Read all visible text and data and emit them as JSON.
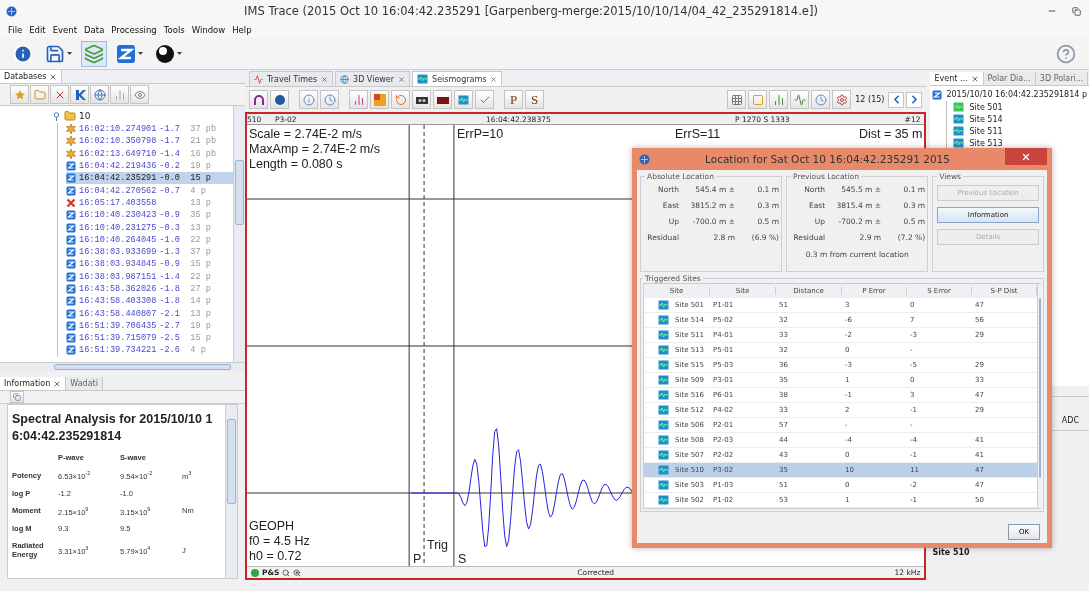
{
  "window": {
    "title": "IMS Trace (2015 Oct 10 16:04:42.235291 [Garpenberg-merge:2015/10/10/14/04_42_235291814.e])"
  },
  "menu": [
    "File",
    "Edit",
    "Event",
    "Data",
    "Processing",
    "Tools",
    "Window",
    "Help"
  ],
  "databases": {
    "tab": "Databases",
    "tree": [
      {
        "label": "10",
        "expanded": true,
        "children": [
          {
            "kind": "star",
            "time": "16:02:10.274901",
            "mag": "-1.7",
            "count": "37 pb",
            "selected": false
          },
          {
            "kind": "star",
            "time": "16:02:10.350798",
            "mag": "-1.7",
            "count": "21 pb",
            "selected": false
          },
          {
            "kind": "star",
            "time": "16:02:13.649710",
            "mag": "-1.4",
            "count": "16 pb",
            "selected": false
          },
          {
            "kind": "z",
            "time": "16:04:42.219436",
            "mag": "-0.2",
            "count": "19 p",
            "selected": false
          },
          {
            "kind": "z",
            "time": "16:04:42.235291",
            "mag": "-0.0",
            "count": "15 p",
            "selected": true
          },
          {
            "kind": "z",
            "time": "16:04:42.270562",
            "mag": "-0.7",
            "count": "4 p",
            "selected": false
          },
          {
            "kind": "x",
            "time": "16:05:17.403558",
            "count": "13 p",
            "selected": false
          },
          {
            "kind": "z",
            "time": "16:10:40.230423",
            "mag": "-0.9",
            "count": "35 p",
            "selected": false
          },
          {
            "kind": "z",
            "time": "16:10:40.231275",
            "mag": "-0.3",
            "count": "13 p",
            "selected": false
          },
          {
            "kind": "z",
            "time": "16:10:40.264045",
            "mag": "-1.0",
            "count": "22 p",
            "selected": false
          },
          {
            "kind": "z",
            "time": "16:38:03.933699",
            "mag": "-1.3",
            "count": "37 p",
            "selected": false
          },
          {
            "kind": "z",
            "time": "16:38:03.934845",
            "mag": "-0.9",
            "count": "15 p",
            "selected": false
          },
          {
            "kind": "z",
            "time": "16:38:03.987151",
            "mag": "-1.4",
            "count": "22 p",
            "selected": false
          },
          {
            "kind": "z",
            "time": "16:43:58.362026",
            "mag": "-1.8",
            "count": "27 p",
            "selected": false
          },
          {
            "kind": "z",
            "time": "16:43:58.403308",
            "mag": "-1.8",
            "count": "14 p",
            "selected": false
          },
          {
            "kind": "z",
            "time": "16:43:58.440807",
            "mag": "-2.1",
            "count": "13 p",
            "selected": false
          },
          {
            "kind": "z",
            "time": "16:51:39.706435",
            "mag": "-2.7",
            "count": "19 p",
            "selected": false
          },
          {
            "kind": "z",
            "time": "16:51:39.715079",
            "mag": "-2.5",
            "count": "15 p",
            "selected": false
          },
          {
            "kind": "z",
            "time": "16:51:39.734221",
            "mag": "-2.6",
            "count": "4 p",
            "selected": false
          }
        ]
      }
    ]
  },
  "information": {
    "tabs": [
      {
        "label": "Information",
        "selected": true
      },
      {
        "label": "Wadati",
        "selected": false
      }
    ],
    "heading": "Spectral Analysis for 2015/10/10 16:04:42.235291814",
    "columns": [
      "P-wave",
      "S-wave"
    ],
    "rows": [
      {
        "label": "Potency",
        "p": "6.53×10$^{-2}$",
        "s": "9.54×10$^{-2}$",
        "unit": "m$^{3}$"
      },
      {
        "label": "log P",
        "p": "-1.2",
        "s": "-1.0"
      },
      {
        "label": "Moment",
        "p": "2.15×10$^{9}$",
        "s": "3.15×10$^{9}$",
        "unit": "Nm"
      },
      {
        "label": "log M",
        "p": "9.3",
        "s": "9.5"
      },
      {
        "label": "Radiated Energy",
        "p": "3.31×10$^{3}$",
        "s": "5.79×10$^{4}$",
        "unit": "J"
      }
    ]
  },
  "center": {
    "tabs": [
      {
        "label": "Travel Times",
        "selected": false
      },
      {
        "label": "3D Viewer",
        "selected": false
      },
      {
        "label": "Seismograms",
        "selected": true
      }
    ],
    "pick_buttons": [
      "P",
      "S"
    ],
    "trace_count": "12 (15)",
    "header": [
      "510",
      "P3-02",
      "16:04:42.238375",
      "P 1270 S 1333",
      "#12"
    ],
    "info": [
      "Scale = 2.74E-2 m/s",
      "MaxAmp = 2.74E-2 m/s",
      "Length = 0.080 s"
    ],
    "err_p": "ErrP=10",
    "err_s": "ErrS=11",
    "dist": "Dist = 35 m",
    "sensor": [
      "GEOPH",
      "f0 = 4.5 Hz",
      "h0 = 0.72"
    ],
    "picks": {
      "p": "P",
      "trig": "Trig",
      "s": "S"
    },
    "status": {
      "mode": "P&S",
      "correction": "Corrected",
      "rate": "12 kHz"
    }
  },
  "right": {
    "tabs": [
      {
        "label": "Event ...",
        "selected": true
      },
      {
        "label": "Polar Dia...",
        "selected": false
      },
      {
        "label": "3D Polari...",
        "selected": false
      }
    ],
    "tree": {
      "label": "2015/10/10 16:04:42.235291814 p",
      "children": [
        "Site 501",
        "Site 514",
        "Site 511",
        "Site 513"
      ]
    },
    "lower_tab": "ADC",
    "site": "Site 510"
  },
  "dialog": {
    "title": "Location for Sat Oct 10 16:04:42.235291 2015",
    "absolute": {
      "title": "Absolute Location",
      "rows": [
        {
          "label": "North",
          "value": "545.4 m ±",
          "error": "0.1 m"
        },
        {
          "label": "East",
          "value": "3815.2 m ±",
          "error": "0.3 m"
        },
        {
          "label": "Up",
          "value": "-700.0 m ±",
          "error": "0.5 m"
        },
        {
          "label": "Residual",
          "value": "2.8 m",
          "error": "(6.9 %)"
        }
      ]
    },
    "previous": {
      "title": "Previous Location",
      "rows": [
        {
          "label": "North",
          "value": "545.5 m ±",
          "error": "0.1 m"
        },
        {
          "label": "East",
          "value": "3815.4 m ±",
          "error": "0.3 m"
        },
        {
          "label": "Up",
          "value": "-700.2 m ±",
          "error": "0.5 m"
        },
        {
          "label": "Residual",
          "value": "2.9 m",
          "error": "(7.2 %)"
        }
      ],
      "note": "0.3 m from current location"
    },
    "views": {
      "title": "Views",
      "buttons": [
        {
          "label": "Previous Location",
          "disabled": true
        },
        {
          "label": "Information",
          "disabled": false
        },
        {
          "label": "Details",
          "disabled": true
        }
      ]
    },
    "sites": {
      "title": "Triggered Sites",
      "columns": [
        "Site",
        "Site",
        "Distance",
        "P Error",
        "S Error",
        "S-P Dist"
      ],
      "rows": [
        {
          "cells": [
            "Site 501",
            "P1-01",
            "51",
            "3",
            "0",
            "47"
          ],
          "selected": false
        },
        {
          "cells": [
            "Site 514",
            "P5-02",
            "32",
            "-6",
            "7",
            "56"
          ],
          "selected": false
        },
        {
          "cells": [
            "Site 511",
            "P4-01",
            "33",
            "-2",
            "-3",
            "29"
          ],
          "selected": false
        },
        {
          "cells": [
            "Site 513",
            "P5-01",
            "32",
            "0",
            "-"
          ],
          "selected": false
        },
        {
          "cells": [
            "Site 515",
            "P5-03",
            "36",
            "-3",
            "-5",
            "29"
          ],
          "selected": false
        },
        {
          "cells": [
            "Site 509",
            "P3-01",
            "35",
            "1",
            "0",
            "33"
          ],
          "selected": false
        },
        {
          "cells": [
            "Site 516",
            "P6-01",
            "38",
            "-1",
            "3",
            "47"
          ],
          "selected": false
        },
        {
          "cells": [
            "Site 512",
            "P4-02",
            "33",
            "2",
            "-1",
            "29"
          ],
          "selected": false
        },
        {
          "cells": [
            "Site 506",
            "P2-01",
            "57",
            "-",
            "-"
          ],
          "selected": false
        },
        {
          "cells": [
            "Site 508",
            "P2-03",
            "44",
            "-4",
            "-4",
            "41"
          ],
          "selected": false
        },
        {
          "cells": [
            "Site 507",
            "P2-02",
            "43",
            "0",
            "-1",
            "41"
          ],
          "selected": false
        },
        {
          "cells": [
            "Site 510",
            "P3-02",
            "35",
            "10",
            "11",
            "47"
          ],
          "selected": true
        },
        {
          "cells": [
            "Site 503",
            "P1-03",
            "51",
            "0",
            "-2",
            "47"
          ],
          "selected": false
        },
        {
          "cells": [
            "Site 502",
            "P1-02",
            "53",
            "1",
            "-1",
            "50"
          ],
          "selected": false
        }
      ]
    },
    "ok": "OK"
  }
}
